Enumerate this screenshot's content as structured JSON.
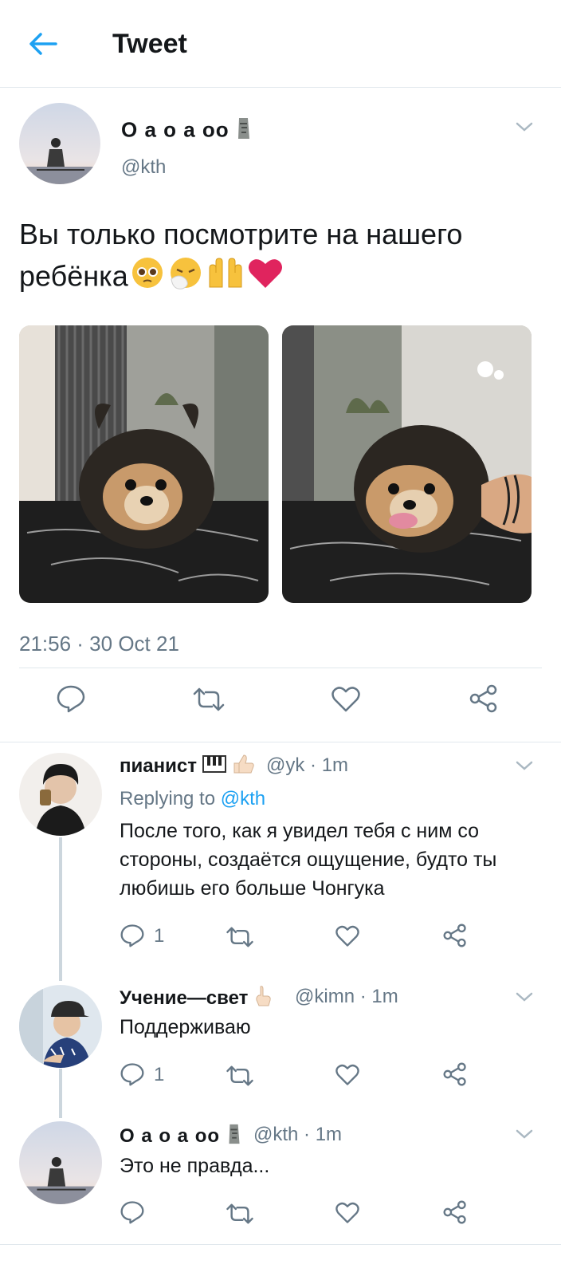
{
  "header": {
    "title": "Tweet"
  },
  "tweet": {
    "author_name": "О а о а оо",
    "author_handle": "@kth",
    "text": "Вы только посмотрите на нашего ребёнка",
    "timestamp": "21:56 · 30 Oct 21",
    "photos": [
      "dog-photo-1",
      "dog-photo-2"
    ]
  },
  "replies": [
    {
      "name": "пианист",
      "meta": "@yk · 1m",
      "replying_prefix": "Replying to",
      "replying_handle": "@kth",
      "text": "После того, как я увидел тебя с ним со стороны, создаётся ощущение, будто ты любишь его больше Чонгука",
      "reply_count": "1"
    },
    {
      "name": "Учение—свет",
      "meta": "@kimn · 1m",
      "text": "Поддерживаю",
      "reply_count": "1"
    },
    {
      "name": "О а о а оо",
      "meta": "@kth · 1m",
      "text": "Это не правда...",
      "reply_count": ""
    }
  ],
  "colors": {
    "accent": "#1da1f2",
    "secondary_text": "#657786",
    "divider": "#e1e8ed",
    "heart_emoji": "#e0245e"
  }
}
